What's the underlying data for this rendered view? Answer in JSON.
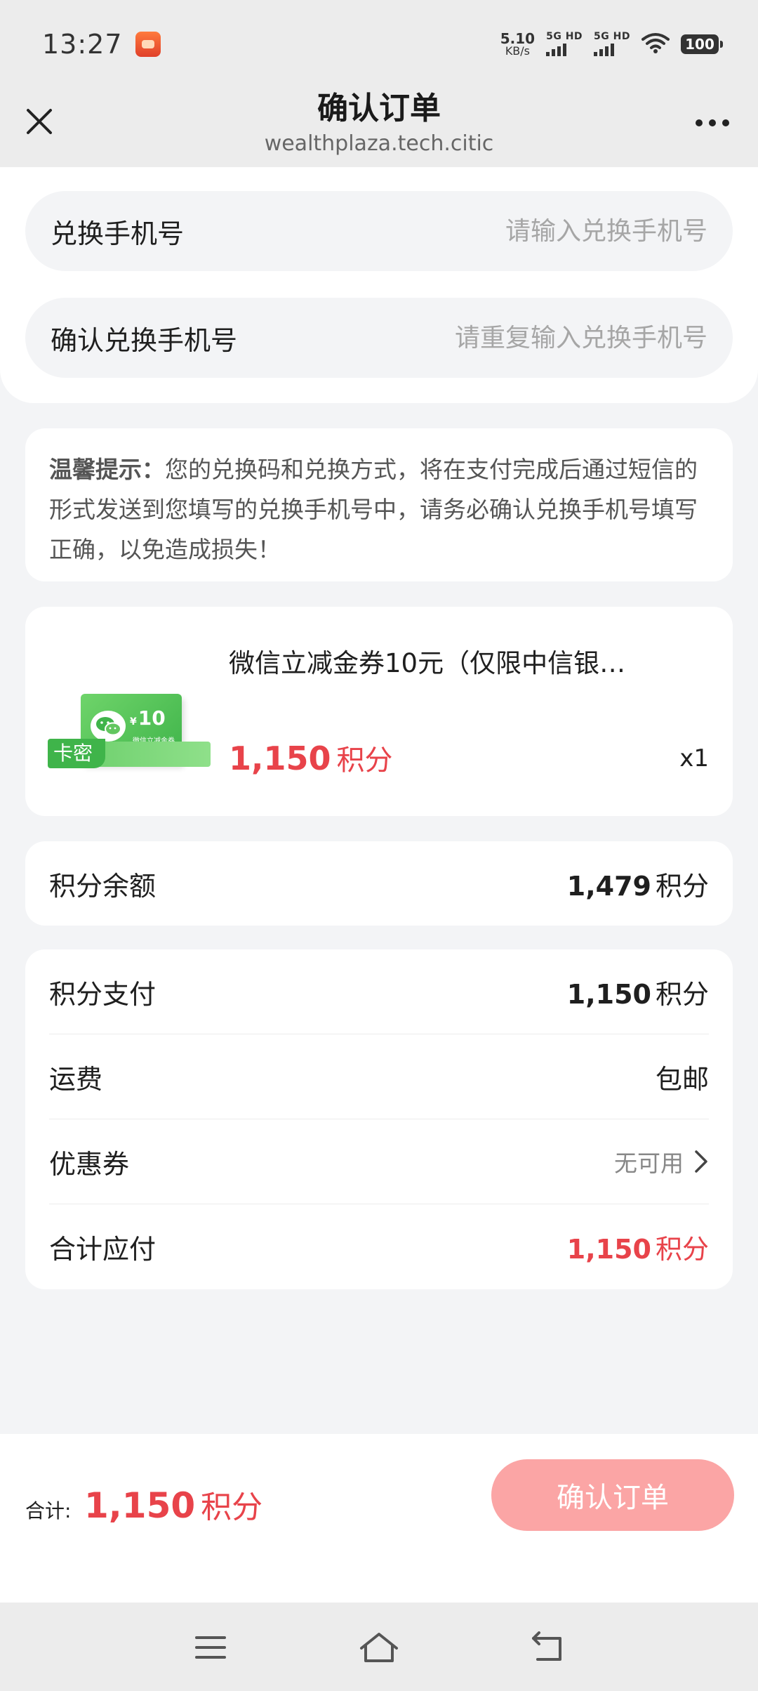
{
  "status_bar": {
    "time": "13:27",
    "net_speed": "5.10",
    "net_unit": "KB/s",
    "sim1": "5G HD",
    "sim2": "5G HD",
    "battery": "100"
  },
  "header": {
    "title": "确认订单",
    "url": "wealthplaza.tech.citic"
  },
  "form": {
    "phone_label": "兑换手机号",
    "phone_placeholder": "请输入兑换手机号",
    "confirm_phone_label": "确认兑换手机号",
    "confirm_phone_placeholder": "请重复输入兑换手机号"
  },
  "notice": {
    "title": "温馨提示：",
    "text": "您的兑换码和兑换方式，将在支付完成后通过短信的形式发送到您填写的兑换手机号中，请务必确认兑换手机号填写正确，以免造成损失！"
  },
  "product": {
    "title": "微信立减金券10元（仅限中信银…",
    "price": "1,150",
    "price_unit": "积分",
    "quantity": "x1",
    "tag": "卡密",
    "coupon_amount": "10",
    "coupon_currency": "¥",
    "coupon_subtitle": "微信立减金券"
  },
  "balance": {
    "label": "积分余额",
    "value": "1,479",
    "unit": "积分"
  },
  "summary": {
    "points_pay_label": "积分支付",
    "points_pay_value": "1,150",
    "points_pay_unit": "积分",
    "shipping_label": "运费",
    "shipping_value": "包邮",
    "coupon_label": "优惠券",
    "coupon_value": "无可用",
    "total_label": "合计应付",
    "total_value": "1,150",
    "total_unit": "积分"
  },
  "bottom_bar": {
    "total_label": "合计:",
    "total_value": "1,150",
    "total_unit": "积分",
    "confirm_label": "确认订单"
  },
  "colors": {
    "accent_red": "#e8434a",
    "button_disabled": "#fba5a5",
    "coupon_green": "#3fb44a"
  },
  "icons": [
    "close-icon",
    "more-icon",
    "chevron-right-icon",
    "menu-icon",
    "home-icon",
    "back-icon",
    "wechat-icon",
    "wifi-icon"
  ]
}
